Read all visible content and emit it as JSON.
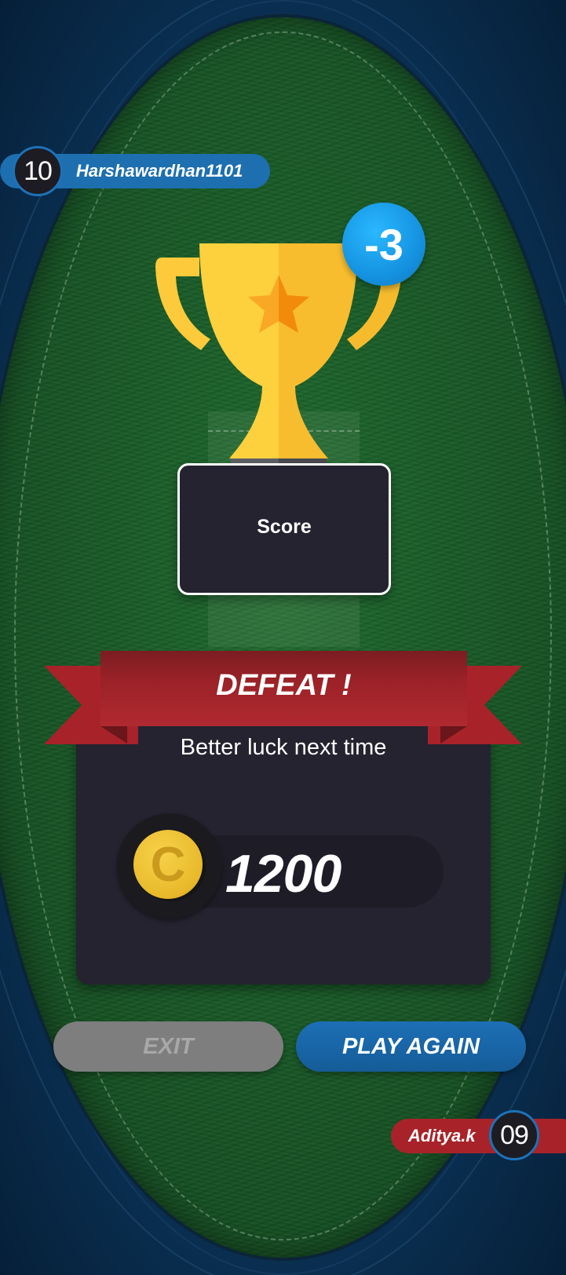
{
  "players": {
    "top": {
      "rank": "10",
      "name": "Harshawardhan1101"
    },
    "bottom": {
      "rank": "09",
      "name": "Aditya.k"
    }
  },
  "trophy": {
    "badge": "-3",
    "score_label": "Score"
  },
  "result": {
    "title": "DEFEAT !",
    "subtitle": "Better luck next time",
    "coin_symbol": "C",
    "coins": "1200"
  },
  "buttons": {
    "exit": "EXIT",
    "play_again": "PLAY AGAIN"
  },
  "colors": {
    "accent_blue": "#1d72b8",
    "ribbon_red": "#9b2228",
    "trophy_gold": "#fdd13d",
    "panel_dark": "#24232f"
  },
  "icons": {
    "trophy": "trophy-icon",
    "star": "star-icon",
    "coin": "coin-icon"
  }
}
